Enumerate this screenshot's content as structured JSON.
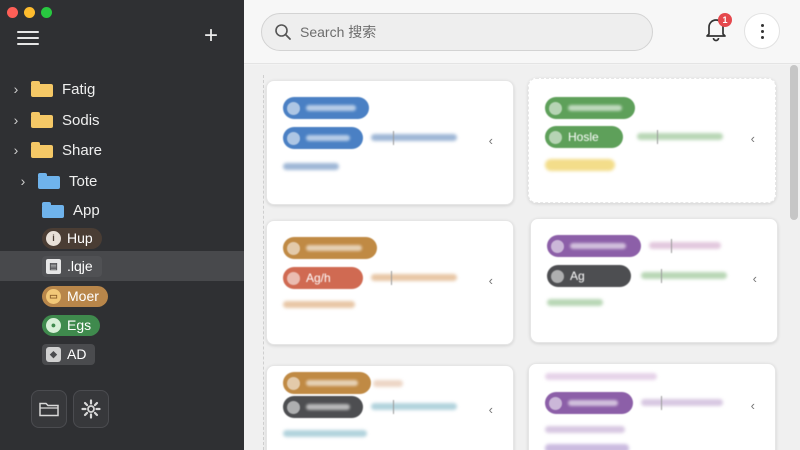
{
  "sidebar": {
    "folders": [
      {
        "label": "Fatig",
        "color": "yellow"
      },
      {
        "label": "Sodis",
        "color": "yellow"
      },
      {
        "label": "Share",
        "color": "yellow"
      },
      {
        "label": "Tote",
        "color": "blue"
      },
      {
        "label": "App",
        "color": "blue"
      }
    ],
    "tags": [
      {
        "label": "Hup",
        "color": "#4a3d34",
        "icon": "info-icon",
        "glyph": "i"
      },
      {
        "label": ".lqje",
        "color": "#505154",
        "icon": "document-icon",
        "glyph": "▤"
      },
      {
        "label": "Moer",
        "color": "#b8864a",
        "icon": "folder-icon",
        "glyph": "▭"
      },
      {
        "label": "Egs",
        "color": "#3f8a4d",
        "icon": "user-icon",
        "glyph": "●"
      },
      {
        "label": "AD",
        "color": "#4a4b4e",
        "icon": "app-icon",
        "glyph": "◆"
      }
    ]
  },
  "topbar": {
    "search_placeholder": "Search 搜索",
    "notification_count": "1"
  },
  "cards": [
    {
      "pill1": "",
      "pill1_color": "#4a80c4",
      "pill2": "",
      "pill2_color": "#4a80c4",
      "bar_color": "#9fb7d6",
      "tag_color": "#b9cde6"
    },
    {
      "pill1": "",
      "pill1_color": "#5ea05a",
      "pill2": "Hosle",
      "pill2_color": "#5ea05a",
      "bar_color": "#b9d7b6",
      "tag_color": "#f3dd8a"
    },
    {
      "pill1": "",
      "pill1_color": "#c08a44",
      "pill2": "Ag/h",
      "pill2_color": "#d06a52",
      "bar_color": "#e8c7a6",
      "tag_color": "#edd0b8"
    },
    {
      "pill1": "",
      "pill1_color": "#8c5fa8",
      "pill2": "Ag",
      "pill2_color": "#4d4e51",
      "bar_color": "#b9d7b6",
      "tag_color": "#bfe0bd"
    },
    {
      "pill1": "",
      "pill1_color": "#c08a44",
      "pill2": "",
      "pill2_color": "#4d4e51",
      "bar_color": "#b2d3dd",
      "tag_color": "#e4d8cf"
    },
    {
      "pill1": "",
      "pill1_color": "#8c5fa8",
      "pill2": "",
      "pill2_color": "#8c5fa8",
      "bar_color": "#d8c8e2",
      "tag_color": "#cbbbe0"
    }
  ],
  "colors": {
    "sidebar": "#2f3033",
    "accent_red": "#e5484d"
  }
}
